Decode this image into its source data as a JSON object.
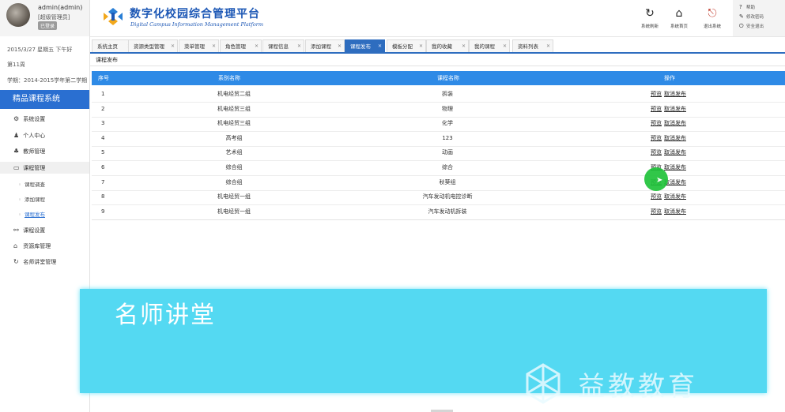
{
  "user": {
    "name": "admin(admin)",
    "role": "[超级管理员]",
    "status": "已登录"
  },
  "info": {
    "date": "2015/3/27 星期五 下午好",
    "day": "第11周",
    "term": "学期：2014-2015学年第二学期"
  },
  "sidebar": {
    "system_title": "精品课程系统",
    "items": [
      {
        "icon": "gear-icon",
        "glyph": "⚙",
        "label": "系统设置"
      },
      {
        "icon": "user-icon",
        "glyph": "♟",
        "label": "个人中心"
      },
      {
        "icon": "group-icon",
        "glyph": "♣",
        "label": "教师管理"
      },
      {
        "icon": "book-icon",
        "glyph": "▭",
        "label": "课程管理"
      },
      {
        "icon": "link-icon",
        "glyph": "⚯",
        "label": "课程设置"
      },
      {
        "icon": "bank-icon",
        "glyph": "⌂",
        "label": "资源库管理"
      },
      {
        "icon": "refresh-icon",
        "glyph": "↻",
        "label": "名师讲堂管理"
      }
    ],
    "sub_items": [
      {
        "label": "课程调查"
      },
      {
        "label": "添加课程"
      },
      {
        "label": "课程发布"
      }
    ]
  },
  "header": {
    "title": "数字化校园综合管理平台",
    "subtitle": "Digital Campus Information Management Platform",
    "buttons": [
      {
        "icon": "refresh-icon",
        "glyph": "↻",
        "label": "系统刷新"
      },
      {
        "icon": "home-icon",
        "glyph": "⌂",
        "label": "系统首页"
      },
      {
        "icon": "exit-icon",
        "glyph": "⎋",
        "label": "退出系统"
      }
    ],
    "side_links": [
      {
        "icon": "help-icon",
        "glyph": "?",
        "label": "帮助"
      },
      {
        "icon": "pencil-icon",
        "glyph": "✎",
        "label": "修改密码"
      },
      {
        "icon": "power-icon",
        "glyph": "⏻",
        "label": "安全退出"
      }
    ]
  },
  "tabs": [
    {
      "label": "系统主页"
    },
    {
      "label": "资源类型管理"
    },
    {
      "label": "菜单管理"
    },
    {
      "label": "角色管理"
    },
    {
      "label": "课程信息"
    },
    {
      "label": "添加课程"
    },
    {
      "label": "课程发布"
    },
    {
      "label": "模板分配"
    },
    {
      "label": "我的收藏"
    },
    {
      "label": "我的课程"
    },
    {
      "label": "资料列表"
    }
  ],
  "active_tab_index": 6,
  "breadcrumb": "课程发布",
  "table": {
    "columns": [
      "序号",
      "系别名称",
      "课程名称",
      "操作"
    ],
    "rows": [
      {
        "no": "1",
        "group": "机电经贸二组",
        "course": "拆装"
      },
      {
        "no": "2",
        "group": "机电经贸三组",
        "course": "物理"
      },
      {
        "no": "3",
        "group": "机电经贸三组",
        "course": "化学"
      },
      {
        "no": "4",
        "group": "高考组",
        "course": "123"
      },
      {
        "no": "5",
        "group": "艺术组",
        "course": "动画"
      },
      {
        "no": "6",
        "group": "综合组",
        "course": "综合"
      },
      {
        "no": "7",
        "group": "综合组",
        "course": "秋葵组"
      },
      {
        "no": "8",
        "group": "机电经贸一组",
        "course": "汽车发动机电控诊断"
      },
      {
        "no": "9",
        "group": "机电经贸一组",
        "course": "汽车发动机拆装"
      }
    ],
    "op_preview": "预览",
    "op_unpublish": "取消发布"
  },
  "banner": {
    "title": "名师讲堂",
    "brand": "益教教育"
  },
  "colors": {
    "accent": "#2e8ae6",
    "sidebar_title": "#2a6fd1",
    "banner": "#54d9f2",
    "cursor": "#1fc23a"
  }
}
